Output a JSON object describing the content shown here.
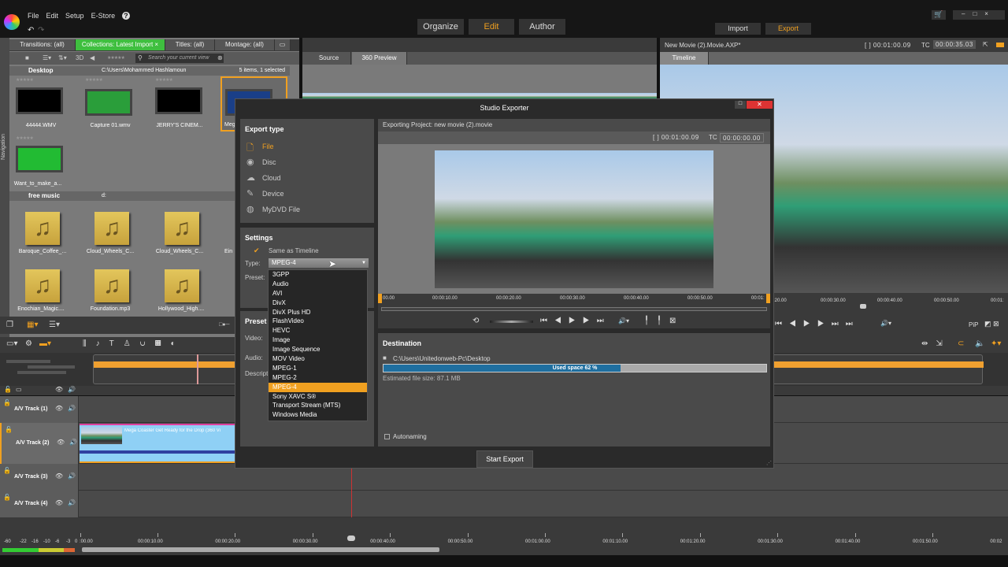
{
  "menu": [
    "File",
    "Edit",
    "Setup",
    "E-Store",
    "?"
  ],
  "modes": {
    "organize": "Organize",
    "edit": "Edit",
    "author": "Author"
  },
  "io": {
    "import": "Import",
    "export": "Export"
  },
  "library": {
    "tabs": [
      "Transitions: (all)",
      "Collections: Latest Import",
      "Titles: (all)",
      "Montage: (all)"
    ],
    "toolbar_3d": "3D",
    "search_placeholder": "Search your current view",
    "navigation_label": "Navigation",
    "desktop": {
      "title": "Desktop",
      "path": "C:\\Users\\Mohammed Hashlamoun",
      "count": "5 items, 1 selected",
      "items": [
        "44444.WMV",
        "Capture 01.wmv",
        "JERRY'S CINEM...",
        "Meg",
        "Want_to_make_a..."
      ]
    },
    "music": {
      "title": "free music",
      "path": "d:",
      "items": [
        "Baroque_Coffee_...",
        "Cloud_Wheels_C...",
        "Cloud_Wheels_C...",
        "Ein",
        "Enochian_Magic....",
        "Foundation.mp3",
        "Hollywood_High...."
      ]
    }
  },
  "source": {
    "tabs": [
      "Source",
      "360 Preview"
    ]
  },
  "movie": {
    "title": "New Movie (2).Movie.AXP*",
    "duration": "[ ] 00:01:00.09",
    "tc_label": "TC",
    "tc": "00:00:35.03",
    "tab": "Timeline",
    "ruler": [
      ":20.00",
      "00:00:30.00",
      "00:00:40.00",
      "00:00:50.00",
      "00:01:"
    ],
    "pip": "PiP"
  },
  "exporter": {
    "title": "Studio Exporter",
    "export_type_title": "Export type",
    "export_types": [
      {
        "label": "File",
        "active": true
      },
      {
        "label": "Disc"
      },
      {
        "label": "Cloud"
      },
      {
        "label": "Device"
      },
      {
        "label": "MyDVD File"
      }
    ],
    "settings_title": "Settings",
    "same_as_timeline": "Same as Timeline",
    "type_label": "Type:",
    "type_value": "MPEG-4",
    "preset_label": "Preset:",
    "type_options": [
      "3GPP",
      "Audio",
      "AVI",
      "DivX",
      "DivX Plus HD",
      "FlashVideo",
      "HEVC",
      "Image",
      "Image Sequence",
      "MOV Video",
      "MPEG-1",
      "MPEG-2",
      "MPEG-4",
      "Sony XAVC S®",
      "Transport Stream (MTS)",
      "Windows Media"
    ],
    "preset_section": "Preset",
    "video_label": "Video:",
    "audio_label": "Audio:",
    "description_label": "Descript",
    "project": "Exporting Project: new movie (2).movie",
    "duration": "[ ] 00:01:00.09",
    "tc_label": "TC",
    "tc": "00:00:00.00",
    "ruler": [
      "00.00",
      "00:00:10.00",
      "00:00:20.00",
      "00:00:30.00",
      "00:00:40.00",
      "00:00:50.00",
      "00:01:"
    ],
    "destination_title": "Destination",
    "destination_path": "C:\\Users\\Unitedonweb-Pc\\Desktop",
    "used_space_label": "Used space 62 %",
    "used_space": 62,
    "estimated_size": "Estimated file size: 87.1 MB",
    "autonaming": "Autonaming",
    "start_export": "Start Export"
  },
  "timeline": {
    "tracks": [
      "A/V Track (1)",
      "A/V Track (2)",
      "A/V Track (3)",
      "A/V Track (4)"
    ],
    "clip_title": "Mega Coaster Get Ready for the Drop (360 Vi",
    "meter_labels": [
      "-60",
      "-22",
      "-16",
      "-10",
      "-6",
      "-3",
      "0"
    ],
    "ruler": [
      ":00.00",
      "00:00:10.00",
      "00:00:20.00",
      "00:00:30.00",
      "00:00:40.00",
      "00:00:50.00",
      "00:01:00.00",
      "00:01:10.00",
      "00:01:20.00",
      "00:01:30.00",
      "00:01:40.00",
      "00:01:50.00",
      "00:02"
    ]
  },
  "colors": {
    "accent": "#f0a020",
    "collections_tab": "#3fbf3f",
    "used_space": "#1f6fa0"
  }
}
